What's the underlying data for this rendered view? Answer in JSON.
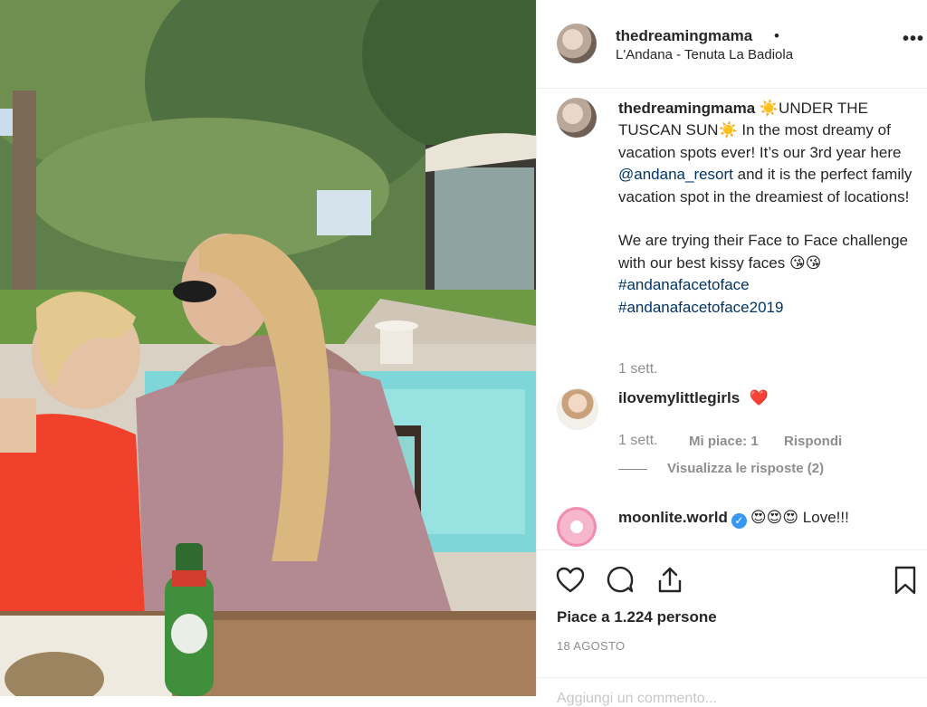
{
  "post": {
    "username": "thedreamingmama",
    "dot": "•",
    "location": "L'Andana - Tenuta La Badiola",
    "more": "•••"
  },
  "caption": {
    "username": "thedreamingmama",
    "text_1": " ☀️UNDER THE TUSCAN SUN☀️ In the most dreamy of vacation spots ever! It’s our 3rd year here ",
    "mention": "@andana_resort",
    "text_2": " and it is the perfect family vacation spot in the dreamiest of locations!\n\nWe are trying their Face to Face challenge with our best kissy faces 😘😘 ",
    "tag_1": "#andanafacetoface",
    "tag_2": "#andanafacetoface2019",
    "time": "1 sett."
  },
  "comments": [
    {
      "username": "ilovemylittlegirls",
      "text": "❤️",
      "time": "1 sett.",
      "likes": "Mi piace: 1",
      "reply": "Rispondi",
      "view_replies": "Visualizza le risposte (2)"
    },
    {
      "username": "moonlite.world",
      "verified": "✓",
      "text": "😍😍😍 Love!!!"
    }
  ],
  "actions": {
    "like_icon": "heart-icon",
    "comment_icon": "comment-icon",
    "share_icon": "share-icon",
    "save_icon": "bookmark-icon"
  },
  "likes_text": "Piace a 1.224 persone",
  "date": "18 AGOSTO",
  "add_comment_placeholder": "Aggiungi un commento..."
}
